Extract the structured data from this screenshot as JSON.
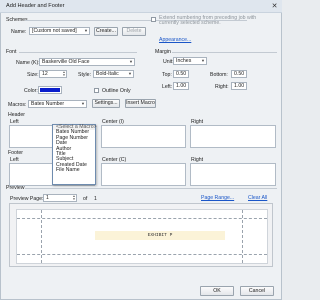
{
  "window": {
    "title": "Add Header and Footer"
  },
  "schemes": {
    "group_label": "Schemes",
    "name_label": "Name:",
    "name_value": "[Custom not saved]",
    "create_label": "Create...",
    "delete_label": "Delete",
    "extend_label": "Extend numbering from preceding job with currently selected scheme.",
    "appearance_link": "Appearance..."
  },
  "font": {
    "group_label": "Font",
    "name_label": "Name (K):",
    "name_value": "Baskerville Old Face",
    "size_label": "Size:",
    "size_value": "12",
    "style_label": "Style:",
    "style_value": "Bold-Italic",
    "color_label": "Color:",
    "color_hex": "#0a1ecc",
    "outline_label": "Outline Only"
  },
  "margin": {
    "group_label": "Margin",
    "unit_label": "Unit:",
    "unit_value": "Inches",
    "top_label": "Top:",
    "top_value": "0.50",
    "bottom_label": "Bottom:",
    "bottom_value": "0.50",
    "left_label": "Left:",
    "left_value": "1.00",
    "right_label": "Right:",
    "right_value": "1.00"
  },
  "macros": {
    "label": "Macros:",
    "selected": "Bates Number",
    "settings_label": "Settings...",
    "insert_label": "Insert Macro",
    "menu_items": [
      "<Select a Macro>",
      "Bates Number",
      "Page Number",
      "Date",
      "Author",
      "Title",
      "Subject",
      "Created Date",
      "File Name"
    ]
  },
  "header": {
    "group_label": "Header",
    "left_label": "Left",
    "center_label": "Center (I)",
    "right_label": "Right"
  },
  "footer": {
    "group_label": "Footer",
    "left_label": "Left",
    "center_label": "Center (C)",
    "right_label": "Right"
  },
  "preview": {
    "group_label": "Preview",
    "page_label": "Preview Page:",
    "page_value": "1",
    "of_label": "of",
    "total_pages": "1",
    "page_range_link": "Page Range...",
    "clear_all_link": "Clear All",
    "watermark_text": "EXHIBIT P"
  },
  "actions": {
    "ok_label": "OK",
    "cancel_label": "Cancel"
  }
}
